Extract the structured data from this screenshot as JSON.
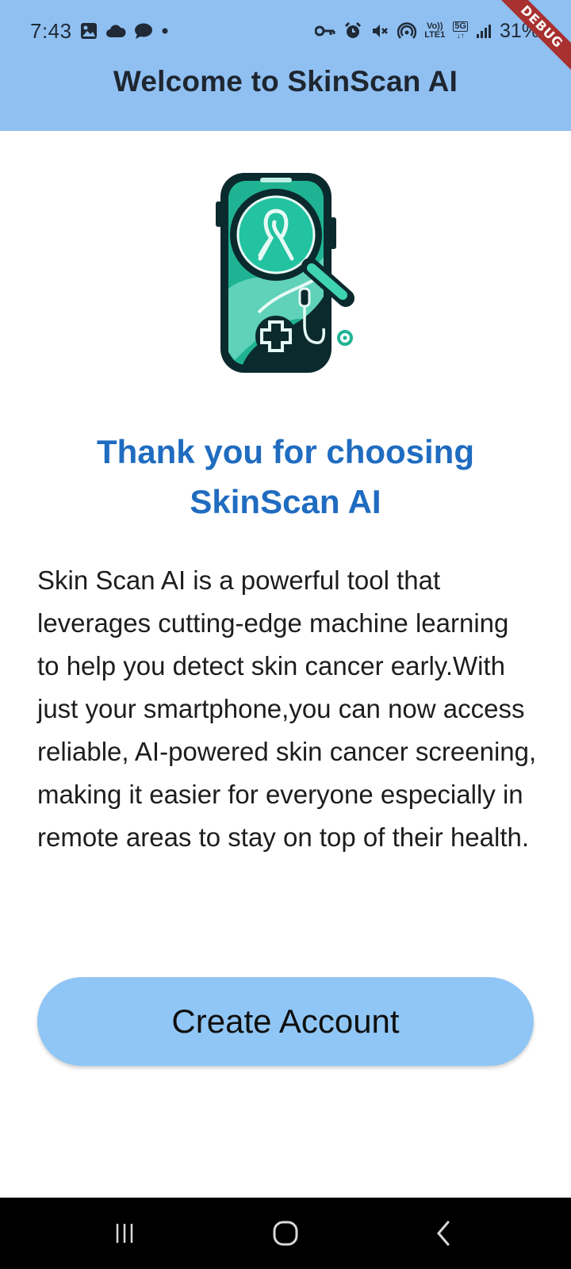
{
  "status_bar": {
    "time": "7:43",
    "network_labels": [
      "Vo))",
      "LTE1",
      "5G"
    ],
    "battery": "31%"
  },
  "app_bar": {
    "title": "Welcome to SkinScan AI",
    "debug_banner": "DEBUG"
  },
  "main": {
    "logo_icon": "phone-magnifier-ribbon-icon",
    "heading": "Thank you for choosing SkinScan AI",
    "description": "Skin Scan AI is a powerful tool that leverages cutting-edge machine learning to help you detect skin cancer early.With just your smartphone,you can now access reliable, AI-powered skin cancer screening, making it easier for everyone especially in remote areas to stay on top of their health.",
    "create_account_label": "Create Account"
  },
  "nav_bar": {
    "icons": [
      "recents-icon",
      "home-icon",
      "back-icon"
    ]
  },
  "colors": {
    "app_bar": "#90c0f2",
    "heading": "#1f6cc0",
    "button": "#90c6f5",
    "logo_teal": "#20b597",
    "logo_dark": "#0b2a2e"
  }
}
